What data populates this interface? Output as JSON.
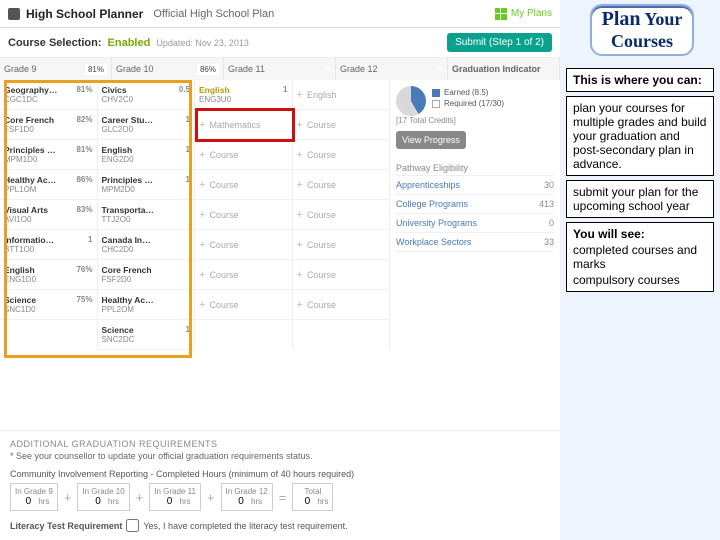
{
  "header": {
    "app_title": "High School Planner",
    "subtitle": "Official High School Plan",
    "myplans_label": "My Plans"
  },
  "status": {
    "label": "Course Selection:",
    "state": "Enabled",
    "updated": "Updated: Nov 23, 2013",
    "submit_label": "Submit (Step 1 of 2)"
  },
  "grades": {
    "cols": [
      {
        "name": "Grade 9",
        "pct": "81%"
      },
      {
        "name": "Grade 10",
        "pct": "86%"
      },
      {
        "name": "Grade 11",
        "pct": ""
      },
      {
        "name": "Grade 12",
        "pct": ""
      }
    ],
    "grad_label": "Graduation Indicator"
  },
  "g9": [
    {
      "title": "Geography…",
      "code": "CGC1DC",
      "pct": "81%"
    },
    {
      "title": "Core French",
      "code": "FSF1D0",
      "pct": "82%"
    },
    {
      "title": "Principles …",
      "code": "MPM1D0",
      "pct": "81%"
    },
    {
      "title": "Healthy Ac…",
      "code": "PPL1OM",
      "pct": "86%"
    },
    {
      "title": "Visual Arts",
      "code": "AVI1O0",
      "pct": "83%"
    },
    {
      "title": "Informatio…",
      "code": "BTT1O0",
      "pct": "1"
    },
    {
      "title": "English",
      "code": "ENG1D0",
      "pct": "76%"
    },
    {
      "title": "Science",
      "code": "SNC1D0",
      "pct": "75%"
    }
  ],
  "g10": [
    {
      "title": "Civics",
      "code": "CHV2C0",
      "pct": "0.5"
    },
    {
      "title": "Career Stu…",
      "code": "GLC2O0",
      "pct": "1"
    },
    {
      "title": "English",
      "code": "ENG2D0",
      "pct": "1"
    },
    {
      "title": "Principles …",
      "code": "MPM2D0",
      "pct": "1"
    },
    {
      "title": "Transporta…",
      "code": "TTJ2O0",
      "pct": ""
    },
    {
      "title": "Canada In…",
      "code": "CHC2D0",
      "pct": ""
    },
    {
      "title": "Core French",
      "code": "FSF2D0",
      "pct": ""
    },
    {
      "title": "Healthy Ac…",
      "code": "PPL2OM",
      "pct": ""
    },
    {
      "title": "Science",
      "code": "SNC2DC",
      "pct": "1"
    }
  ],
  "g11": [
    {
      "title": "English",
      "code": "ENG3U0",
      "pct": "1"
    }
  ],
  "slot_labels": {
    "mathematics": "Mathematics",
    "course": "Course",
    "english": "English"
  },
  "grad": {
    "earned": "Earned (8.5)",
    "required": "Required (17/30)",
    "totals": "[17 Total Credits]",
    "view": "View Progress",
    "elig_title": "Pathway Eligibility",
    "rows": [
      {
        "label": "Apprenticeships",
        "ct": "30"
      },
      {
        "label": "College Programs",
        "ct": "413"
      },
      {
        "label": "University Programs",
        "ct": "0"
      },
      {
        "label": "Workplace Sectors",
        "ct": "33"
      }
    ]
  },
  "addl": {
    "title": "ADDITIONAL GRADUATION REQUIREMENTS",
    "note": "* See your counsellor to update your official graduation requirements status.",
    "ci_title": "Community Involvement Reporting - Completed Hours (minimum of 40 hours required)",
    "ci": [
      {
        "label": "In Grade 9",
        "val": "0"
      },
      {
        "label": "In Grade 10",
        "val": "0"
      },
      {
        "label": "In Grade 11",
        "val": "0"
      },
      {
        "label": "In Grade 12",
        "val": "0"
      }
    ],
    "total_label": "Total",
    "total_val": "0",
    "hrs": "hrs",
    "lit_label": "Literacy Test Requirement",
    "lit_text": "Yes, I have completed the literacy test requirement."
  },
  "side": {
    "title_big": "Plan",
    "title_small": "Your",
    "title_line2": "Courses",
    "intro": "This is where you can:",
    "p1": "plan your courses  for multiple grades and build your graduation and post-secondary plan in advance.",
    "p2": "submit your plan for the upcoming school year",
    "see_hd": "You will see:",
    "see1": "completed courses and marks",
    "see2": "compulsory courses"
  }
}
